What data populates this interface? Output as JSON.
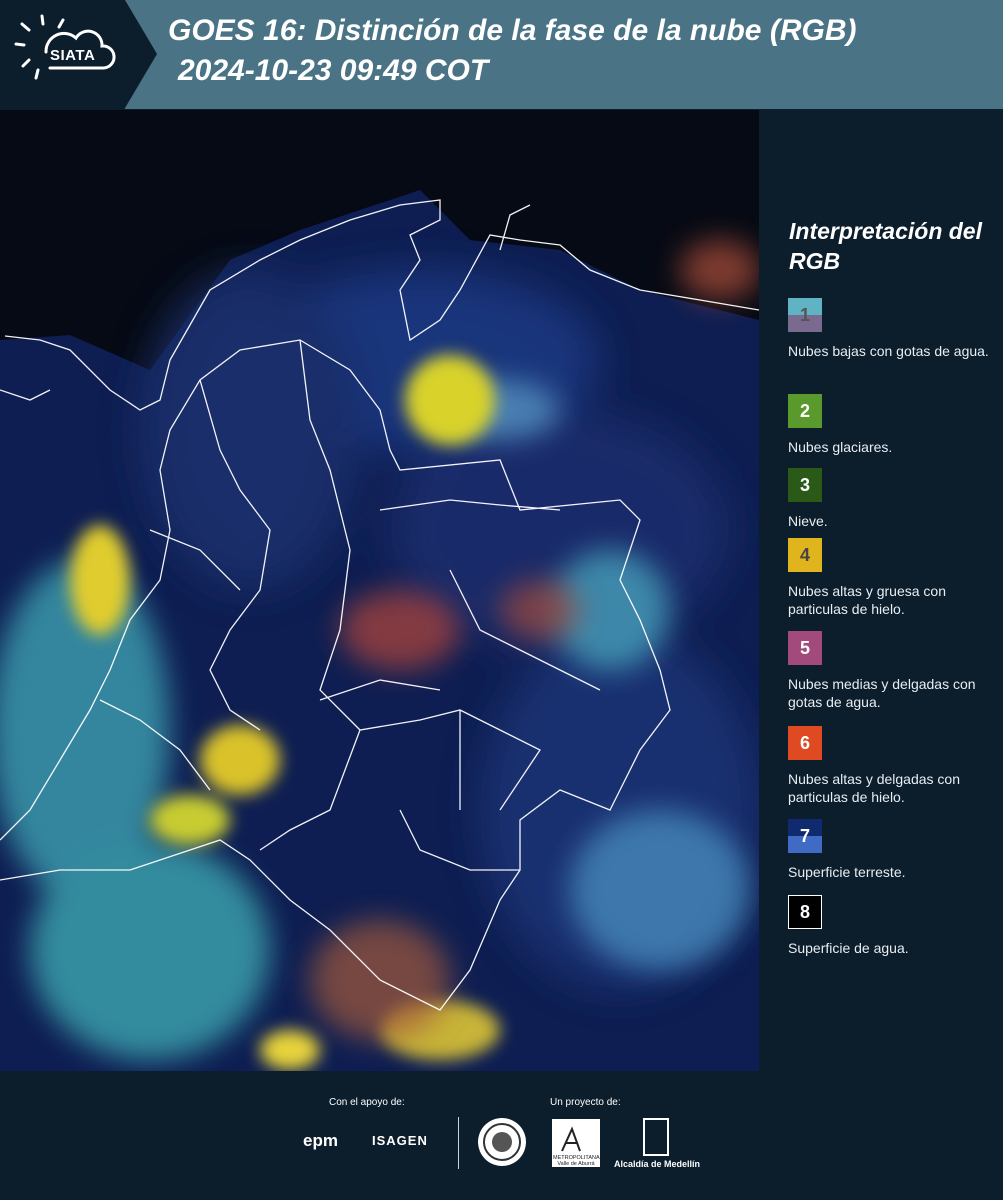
{
  "header": {
    "logo_text": "SIATA",
    "title_line1": "GOES 16: Distinción de la fase de la nube (RGB)",
    "title_line2": "2024-10-23 09:49 COT",
    "background_color": "#4a7486"
  },
  "map": {
    "description_icon": "satellite-rgb-map",
    "background_color": "#091330"
  },
  "legend": {
    "title": "Interpretación del RGB",
    "items": [
      {
        "number": "1",
        "label": "Nubes bajas con gotas de agua.",
        "color_top": "#5fb3c3",
        "color_bottom": "#7a6a8f"
      },
      {
        "number": "2",
        "label": "Nubes glaciares.",
        "color": "#5a9a2c"
      },
      {
        "number": "3",
        "label": "Nieve.",
        "color": "#2b5a18"
      },
      {
        "number": "4",
        "label": "Nubes altas y gruesa con particulas de hielo.",
        "color": "#e0b41c"
      },
      {
        "number": "5",
        "label": "Nubes medias y delgadas con gotas de agua.",
        "color": "#a24a7c"
      },
      {
        "number": "6",
        "label": "Nubes altas y delgadas con particulas de hielo.",
        "color": "#e04a22"
      },
      {
        "number": "7",
        "label": "Superficie terreste.",
        "color_top": "#0f2a6e",
        "color_bottom": "#3f6bc4"
      },
      {
        "number": "8",
        "label": "Superficie de agua.",
        "color": "#000000"
      }
    ]
  },
  "footer": {
    "support_label": "Con el apoyo de:",
    "project_label": "Un proyecto de:",
    "epm": "epm",
    "isagen": "ISAGEN",
    "area_label": "METROPOLITANA Valle de Aburrá",
    "alcaldia": "Alcaldía de Medellín"
  }
}
